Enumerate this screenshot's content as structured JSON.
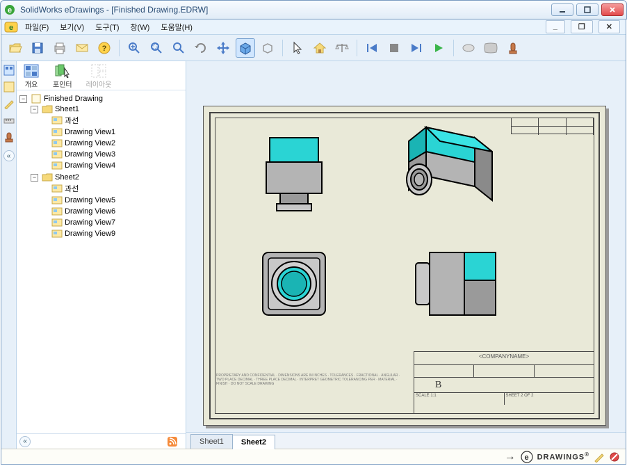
{
  "app_name": "SolidWorks eDrawings",
  "doc_name": "Finished Drawing.EDRW",
  "title_text": "SolidWorks eDrawings - [Finished Drawing.EDRW]",
  "menu": {
    "file": "파일(F)",
    "view": "보기(V)",
    "tools": "도구(T)",
    "window": "창(W)",
    "help": "도움말(H)"
  },
  "side_tools": {
    "overview": "개요",
    "pointer": "포인터",
    "layout": "레이아웃"
  },
  "tree": {
    "root": "Finished Drawing",
    "sheet1": "Sheet1",
    "sheet1_items": [
      "과선",
      "Drawing View1",
      "Drawing View2",
      "Drawing View3",
      "Drawing View4"
    ],
    "sheet2": "Sheet2",
    "sheet2_items": [
      "과선",
      "Drawing View5",
      "Drawing View6",
      "Drawing View7",
      "Drawing View9"
    ]
  },
  "sheets": {
    "tab1": "Sheet1",
    "tab2": "Sheet2",
    "active": "Sheet2"
  },
  "titleblock": {
    "company": "<COMPANYNAME>",
    "size_mark": "B"
  },
  "status": {
    "brand": "DRAWINGS"
  },
  "colors": {
    "accent_teal": "#2ad4d4",
    "body_gray": "#b4b4b4",
    "steel": "#9a9a9a"
  }
}
